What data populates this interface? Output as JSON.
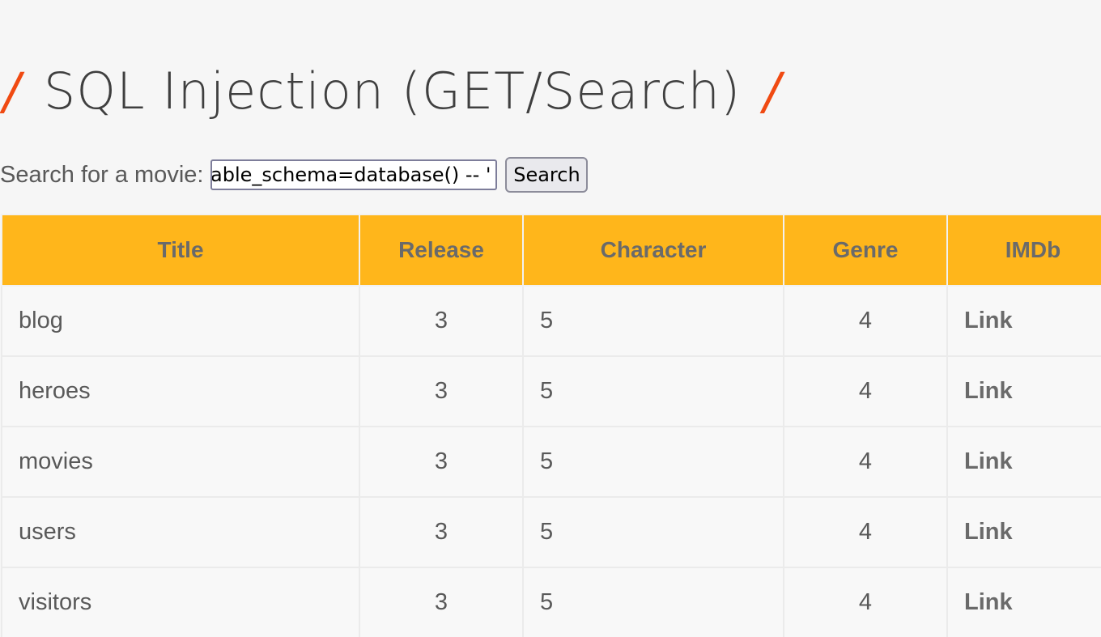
{
  "heading": {
    "slash_left": "/",
    "title": "SQL Injection (GET/Search)",
    "slash_right": "/"
  },
  "search": {
    "label": "Search for a movie:",
    "value": "able_schema=database() -- '",
    "button_label": "Search"
  },
  "table": {
    "headers": [
      "Title",
      "Release",
      "Character",
      "Genre",
      "IMDb"
    ],
    "rows": [
      {
        "title": "blog",
        "release": "3",
        "character": "5",
        "genre": "4",
        "imdb": "Link"
      },
      {
        "title": "heroes",
        "release": "3",
        "character": "5",
        "genre": "4",
        "imdb": "Link"
      },
      {
        "title": "movies",
        "release": "3",
        "character": "5",
        "genre": "4",
        "imdb": "Link"
      },
      {
        "title": "users",
        "release": "3",
        "character": "5",
        "genre": "4",
        "imdb": "Link"
      },
      {
        "title": "visitors",
        "release": "3",
        "character": "5",
        "genre": "4",
        "imdb": "Link"
      }
    ]
  },
  "colors": {
    "accent_slash": "#f04a12",
    "header_bg": "#ffb61b"
  }
}
